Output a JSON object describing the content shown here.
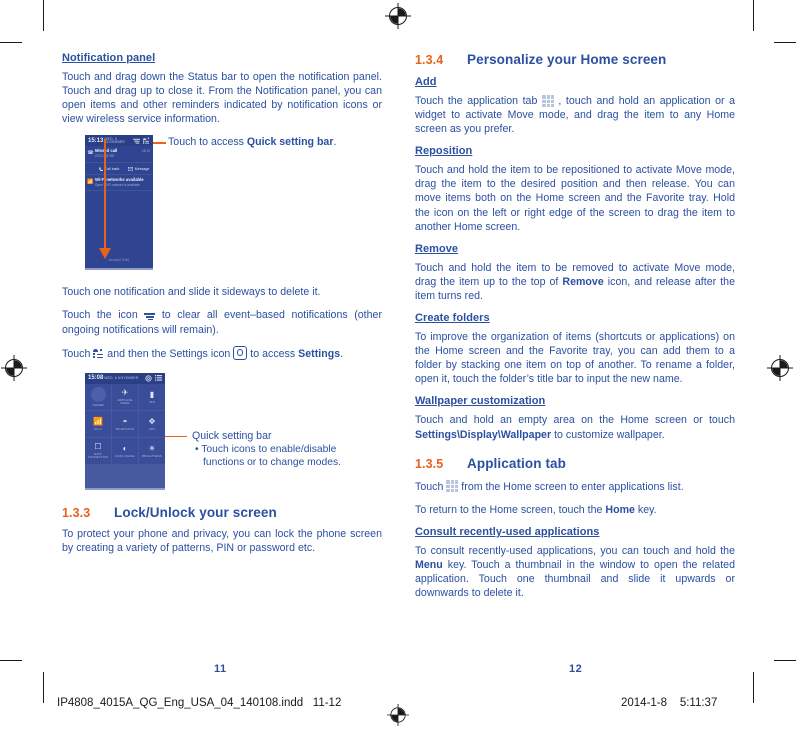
{
  "colors": {
    "body_text": "#2b50a1",
    "accent_orange": "#e8621a",
    "phone_bg": "#2f4591"
  },
  "left_column": {
    "heading": "Notification panel",
    "intro": "Touch and drag down the Status bar to open the notification panel. Touch and drag up to close it. From the Notification panel, you can open items and other reminders indicated by notification icons or view wireless service information.",
    "figure1": {
      "callout_prefix": "Touch to access ",
      "callout_bold": "Quick setting bar",
      "callout_suffix": ".",
      "screen": {
        "clock": "15:13",
        "date": "WED, 6 NOVEMBER",
        "notifications": [
          {
            "title": "Missed call",
            "sub": "0702 283 087",
            "time": "15:12",
            "icon": "missed-call-icon"
          },
          {
            "title": "Wi-Fi networks available",
            "sub": "Open Wi-Fi network is available",
            "icon": "wifi-icon"
          }
        ],
        "actions": [
          {
            "label": "Call back",
            "icon": "phone-icon"
          },
          {
            "label": "Message",
            "icon": "message-icon"
          }
        ],
        "footer": "Invalid SIM"
      }
    },
    "para_delete": "Touch one notification and slide it sideways to delete it.",
    "para_clear_a": "Touch the icon ",
    "para_clear_b": " to clear all event–based notifications (other ongoing notifications will remain).",
    "para_settings_a": "Touch ",
    "para_settings_b": " and then the Settings icon ",
    "para_settings_c": " to access ",
    "para_settings_bold": "Settings",
    "para_settings_d": ".",
    "figure2": {
      "callout_title": "Quick setting bar",
      "callout_bullet_line1": "• Touch icons to enable/disable",
      "callout_bullet_line2": "functions or to change modes.",
      "screen": {
        "clock": "15:08",
        "date": "WED, 6 NOVEMBER",
        "tiles": [
          {
            "label": "OWNER",
            "icon": "avatar-icon"
          },
          {
            "label": "AIRPLANE MODE",
            "icon": "airplane-icon"
          },
          {
            "label": "75%",
            "icon": "battery-icon"
          },
          {
            "label": "WI-FI",
            "icon": "wifi-icon"
          },
          {
            "label": "BLUETOOTH",
            "icon": "bluetooth-icon"
          },
          {
            "label": "GPS",
            "icon": "gps-icon"
          },
          {
            "label": "DATA CONNECTION",
            "icon": "data-connection-icon"
          },
          {
            "label": "DATA USAGE",
            "icon": "data-usage-icon"
          },
          {
            "label": "BRIGHTNESS",
            "icon": "brightness-icon"
          }
        ]
      }
    },
    "section_133": {
      "number": "1.3.3",
      "title": "Lock/Unlock your screen",
      "body": "To protect your phone and privacy, you can lock the phone screen by creating a variety of patterns, PIN or password etc."
    }
  },
  "right_column": {
    "section_134": {
      "number": "1.3.4",
      "title": "Personalize your Home screen"
    },
    "add": {
      "heading": "Add",
      "body_a": "Touch the application tab ",
      "body_b": " , touch and hold an application or a widget to activate Move mode, and drag the item to any Home screen as you prefer."
    },
    "reposition": {
      "heading": "Reposition",
      "body": "Touch and hold the item to be repositioned to activate Move mode, drag the item to the desired position and then release. You can move items both on the Home screen and the Favorite tray. Hold the icon on the left or right edge of the screen to drag the item to another Home screen."
    },
    "remove": {
      "heading": "Remove",
      "body_a": "Touch and hold the item to be removed to activate Move mode, drag the item up to the top of ",
      "body_bold": "Remove",
      "body_b": " icon, and release after the item turns red."
    },
    "create_folders": {
      "heading": "Create folders",
      "body": "To improve the organization of items (shortcuts or applications) on the Home screen and the Favorite tray, you can add them to a folder by stacking one item on top of another. To rename a folder, open it, touch the folder’s title bar to input the new name."
    },
    "wallpaper": {
      "heading": "Wallpaper customization",
      "body_a": "Touch and hold an empty area on the Home screen or touch ",
      "body_bold": "Settings\\Display\\Wallpaper",
      "body_b": " to customize wallpaper."
    },
    "section_135": {
      "number": "1.3.5",
      "title": "Application tab",
      "body_a": "Touch ",
      "body_b": " from the Home screen to enter applications list.",
      "body2_a": "To return to the Home screen, touch the ",
      "body2_bold": "Home",
      "body2_b": " key."
    },
    "consult": {
      "heading": "Consult recently-used applications",
      "body_a": "To consult recently-used applications, you can touch and hold the ",
      "body_bold": "Menu",
      "body_b": " key. Touch a thumbnail in the window to open the related application. Touch one thumbnail and slide it upwards or downwards to delete it."
    }
  },
  "footer": {
    "page_left": "11",
    "page_right": "12",
    "imprint_file": "IP4808_4015A_QG_Eng_USA_04_140108.indd",
    "imprint_pages": "11-12",
    "imprint_date": "2014-1-8",
    "imprint_time": "5:11:37"
  }
}
